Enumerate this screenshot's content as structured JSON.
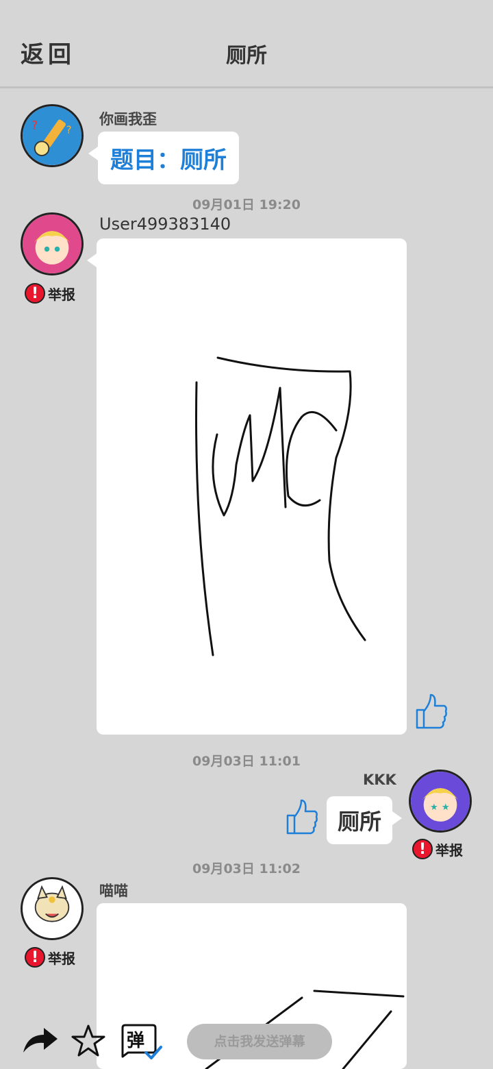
{
  "header": {
    "back_label": "返回",
    "title": "厕所"
  },
  "messages": [
    {
      "sender": "你画我歪",
      "topic_text": "题目：厕所"
    },
    {
      "timestamp": "09月01日 19:20",
      "sender": "User499383140",
      "report_label": "举报"
    },
    {
      "timestamp": "09月03日 11:01",
      "sender": "KKK",
      "text": "厕所",
      "report_label": "举报"
    },
    {
      "timestamp": "09月03日 11:02",
      "sender": "喵喵",
      "report_label": "举报"
    }
  ],
  "bottom_bar": {
    "danmaku_placeholder": "点击我发送弹幕",
    "danmaku_icon_char": "弹",
    "icons": [
      "share-icon",
      "star-icon",
      "danmaku-icon"
    ]
  },
  "colors": {
    "background": "#d6d6d6",
    "accent": "#1e7fd8",
    "report": "#e8172d"
  }
}
